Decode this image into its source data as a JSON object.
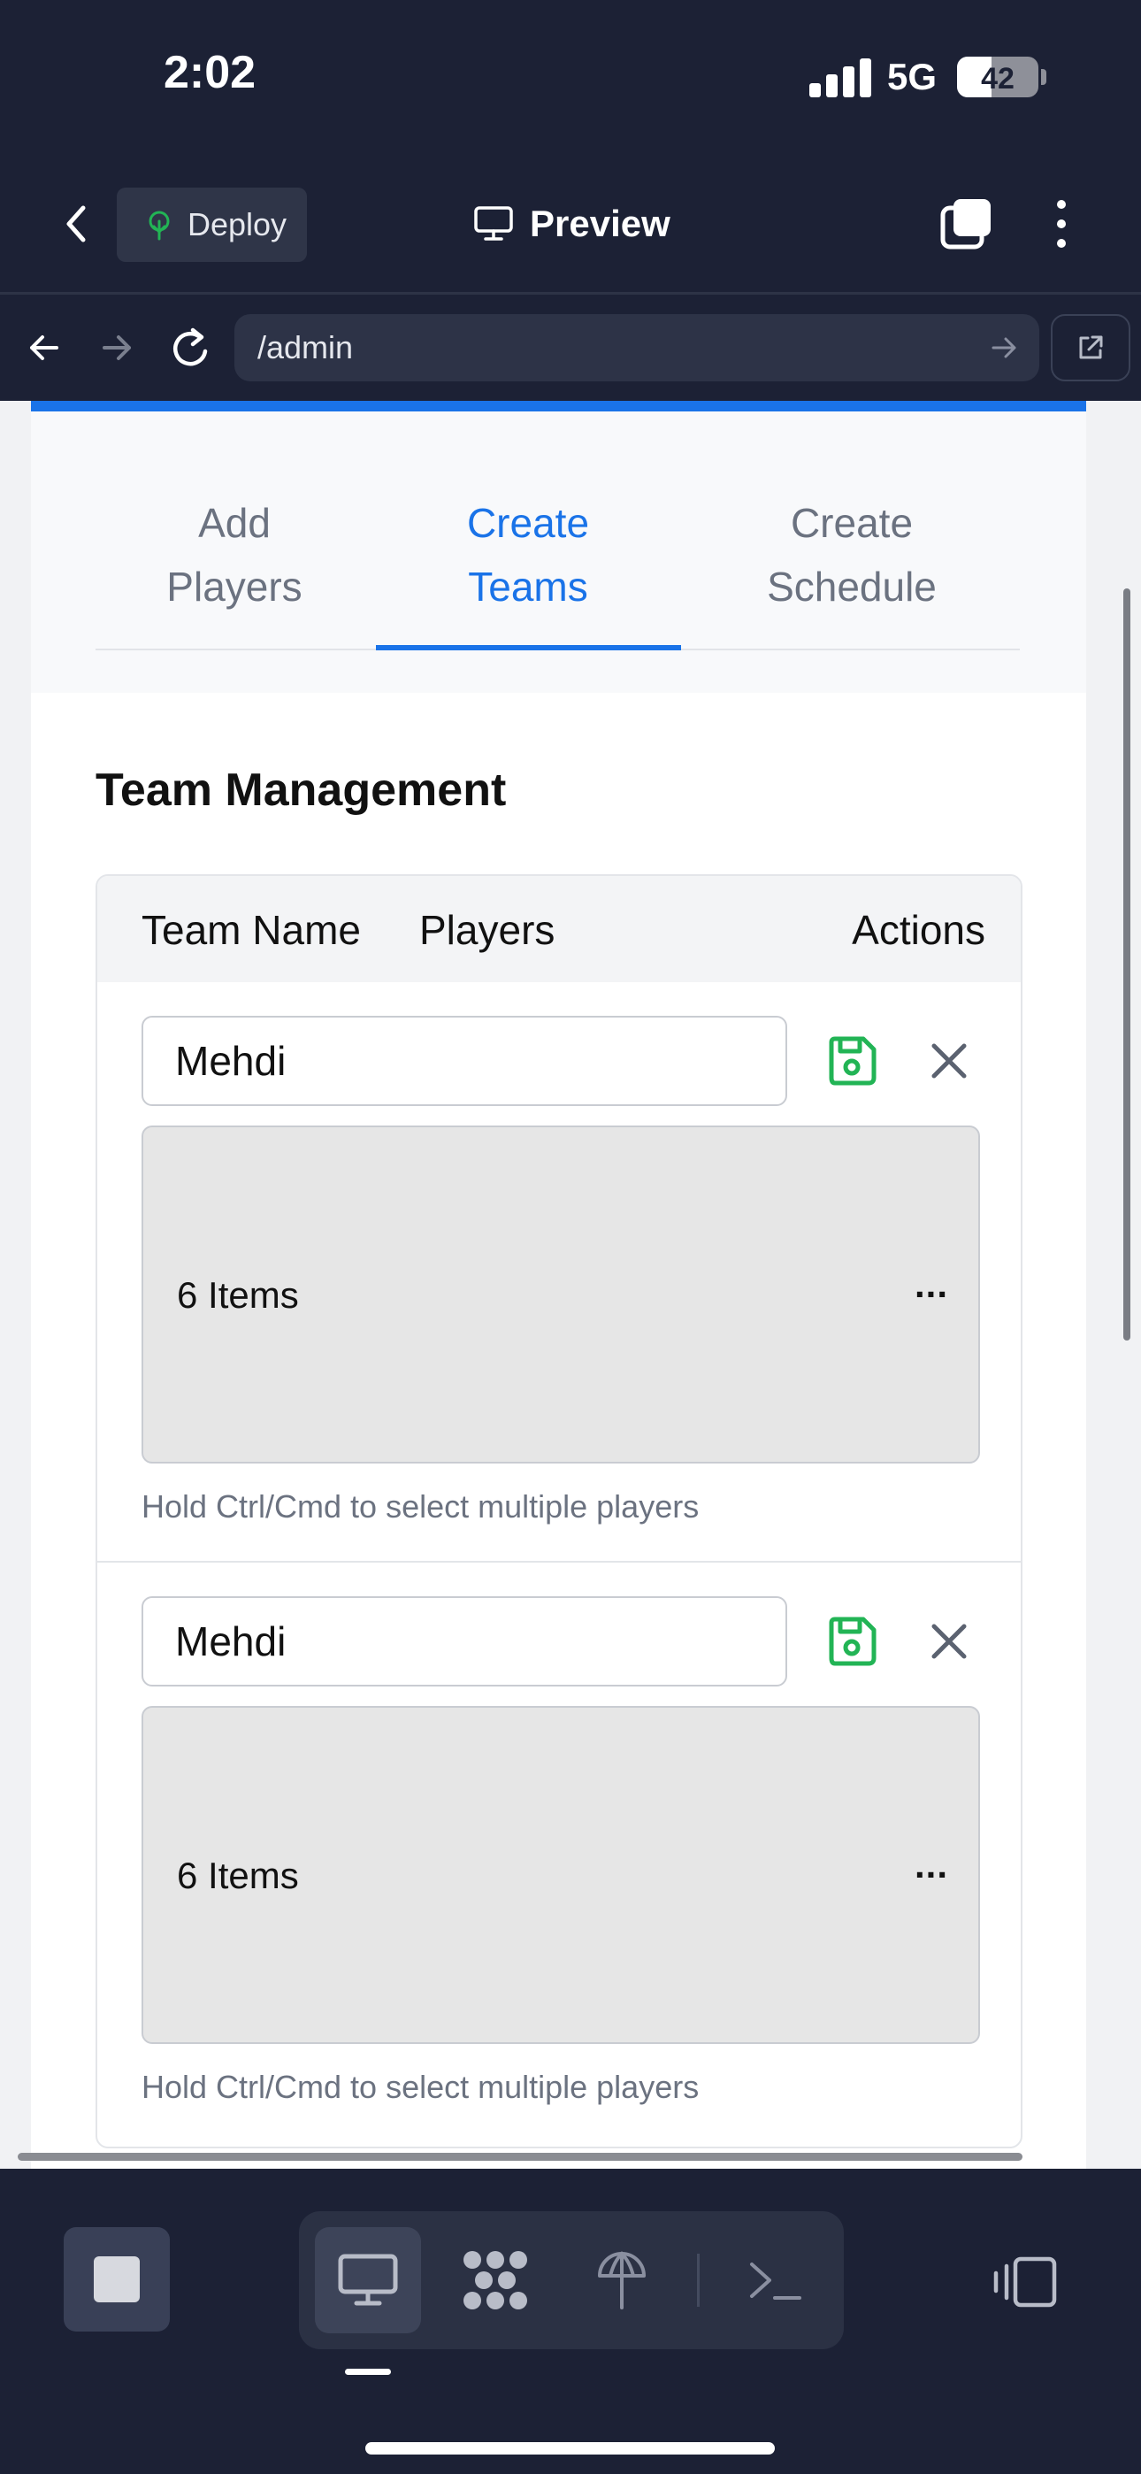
{
  "status_bar": {
    "time": "2:02",
    "network": "5G",
    "battery": "42",
    "battery_level": 0.42
  },
  "toolbar": {
    "deploy_label": "Deploy",
    "preview_label": "Preview"
  },
  "browser": {
    "url": "/admin"
  },
  "tabs": [
    {
      "label_line1": "Add",
      "label_line2": "Players",
      "active": false
    },
    {
      "label_line1": "Create",
      "label_line2": "Teams",
      "active": true
    },
    {
      "label_line1": "Create",
      "label_line2": "Schedule",
      "active": false
    }
  ],
  "section": {
    "title": "Team Management"
  },
  "table": {
    "headers": {
      "team_name": "Team Name",
      "players": "Players",
      "actions": "Actions"
    },
    "rows": [
      {
        "team_name": "Mehdi",
        "players_summary": "6 Items",
        "more": "...",
        "hint": "Hold Ctrl/Cmd to select multiple players"
      },
      {
        "team_name": "Mehdi",
        "players_summary": "6 Items",
        "more": "...",
        "hint": "Hold Ctrl/Cmd to select multiple players"
      }
    ]
  },
  "icons": {
    "back": "chevron-left-icon",
    "deploy": "deploy-icon",
    "preview": "monitor-icon",
    "tabs": "tabs-icon",
    "more": "more-vertical-icon",
    "save": "save-icon",
    "close": "close-icon",
    "stop": "stop-icon",
    "desktop": "monitor-icon",
    "integrations": "integrations-icon",
    "network": "network-icon",
    "terminal": "terminal-icon",
    "layout": "layout-icon"
  },
  "colors": {
    "accent": "#1a73e8",
    "save": "#22b455",
    "chrome": "#1c2135"
  }
}
